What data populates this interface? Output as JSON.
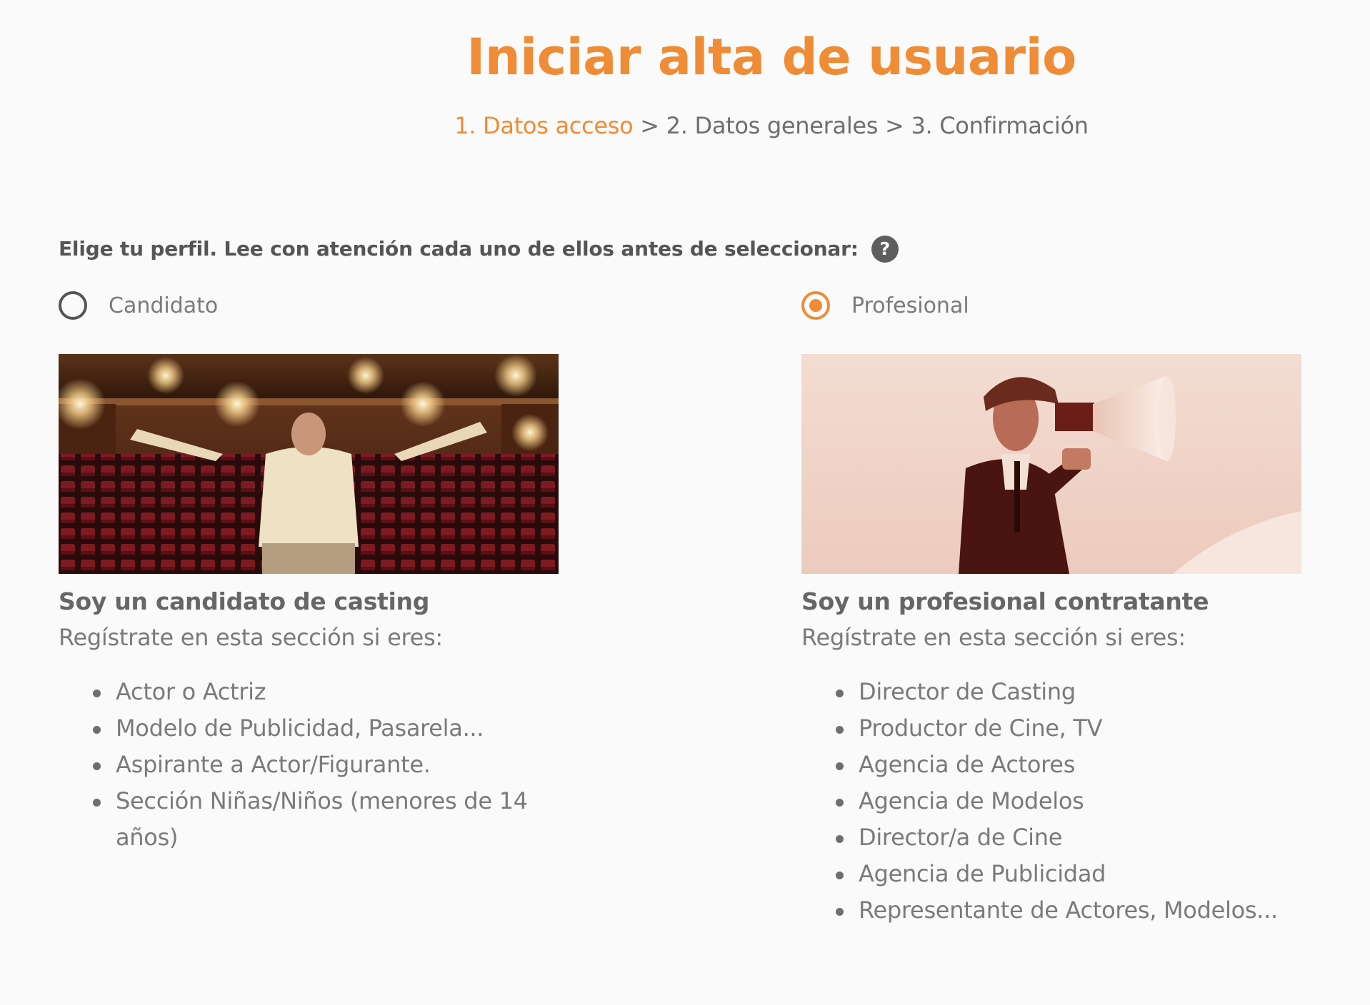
{
  "header": {
    "title": "Iniciar alta de usuario",
    "steps": {
      "step1": "1. Datos acceso",
      "sep1": " > ",
      "step2": "2. Datos generales",
      "sep2": " > ",
      "step3": "3. Confirmación"
    }
  },
  "prompt": {
    "text": "Elige tu perfil. Lee con atención cada uno de ellos antes de seleccionar:",
    "help_glyph": "?"
  },
  "profiles": {
    "candidate": {
      "radio_label": "Candidato",
      "selected": false,
      "image": "theatre-man-arms-open-photo",
      "title": "Soy un candidato de casting",
      "subtitle": "Regístrate en esta sección si eres:",
      "items": [
        "Actor o Actriz",
        "Modelo de Publicidad, Pasarela...",
        "Aspirante a Actor/Figurante.",
        "Sección Niñas/Niños (menores de 14 años)"
      ]
    },
    "professional": {
      "radio_label": "Profesional",
      "selected": true,
      "image": "man-with-megaphone-photo",
      "title": "Soy un profesional contratante",
      "subtitle": "Regístrate en esta sección si eres:",
      "items": [
        "Director de Casting",
        "Productor de Cine, TV",
        "Agencia de Actores",
        "Agencia de Modelos",
        "Director/a de Cine",
        "Agencia de Publicidad",
        "Representante de Actores, Modelos..."
      ]
    }
  },
  "colors": {
    "accent": "#ef8c35",
    "text": "#6e6e6e",
    "background": "#fafafa"
  }
}
